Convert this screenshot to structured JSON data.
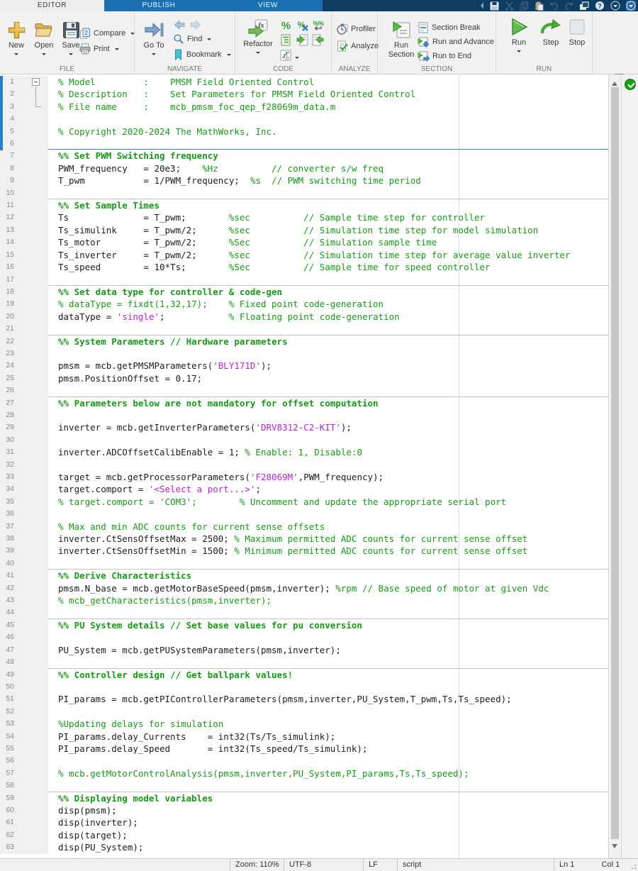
{
  "tabs": [
    "EDITOR",
    "PUBLISH",
    "VIEW"
  ],
  "toolbar": {
    "groups": [
      "FILE",
      "NAVIGATE",
      "CODE",
      "ANALYZE",
      "SECTION",
      "RUN"
    ],
    "file": {
      "new": "New",
      "open": "Open",
      "save": "Save",
      "compare": "Compare",
      "print": "Print"
    },
    "navigate": {
      "goto": "Go To",
      "find": "Find",
      "bookmark": "Bookmark"
    },
    "code": {
      "refactor": "Refactor"
    },
    "analyze": {
      "profiler": "Profiler",
      "analyze": "Analyze"
    },
    "section": {
      "run_line1": "Run",
      "run_line2": "Section",
      "section_break": "Section Break",
      "run_and_advance": "Run and Advance",
      "run_to_end": "Run to End"
    },
    "run": {
      "run": "Run",
      "step": "Step",
      "stop": "Stop"
    }
  },
  "status": {
    "zoom_label": "Zoom: 110%",
    "encoding": "UTF-8",
    "line_ending": "LF",
    "file_type": "script",
    "line": "Ln  1",
    "column": "Col  1"
  },
  "colors": {
    "comment_green": "#169916",
    "string_purple": "#b821cf",
    "section_marker_blue": "#2f86c4",
    "tab_navy": "#0e3c62",
    "tab_blue": "#1a70b1",
    "analyzer_ok_green": "#18a018"
  },
  "editor": {
    "current_section_lines": [
      1,
      6
    ],
    "lines": [
      {
        "n": 1,
        "segs": [
          [
            "% Model         :    PMSM Field Oriented Control",
            "com"
          ]
        ]
      },
      {
        "n": 2,
        "segs": [
          [
            "% Description   :    Set Parameters for PMSM Field Oriented Control",
            "com"
          ]
        ]
      },
      {
        "n": 3,
        "segs": [
          [
            "% File name     :    mcb_pmsm_foc_qep_f28069m_data.m",
            "com"
          ]
        ]
      },
      {
        "n": 4,
        "segs": []
      },
      {
        "n": 5,
        "segs": [
          [
            "% Copyright 2020-2024 The MathWorks, Inc.",
            "com"
          ]
        ]
      },
      {
        "n": 6,
        "segs": []
      },
      {
        "n": 7,
        "sb": "blue",
        "segs": [
          [
            "%% Set PWM Switching frequency",
            "sec"
          ]
        ]
      },
      {
        "n": 8,
        "segs": [
          [
            "PWM_frequency   = 20e3;    ",
            "code"
          ],
          [
            "%Hz          // converter s/w freq",
            "com"
          ]
        ]
      },
      {
        "n": 9,
        "segs": [
          [
            "T_pwm           = 1/PWM_frequency;  ",
            "code"
          ],
          [
            "%s  // PWM switching time period",
            "com"
          ]
        ]
      },
      {
        "n": 10,
        "segs": []
      },
      {
        "n": 11,
        "sb": "gray",
        "segs": [
          [
            "%% Set Sample Times",
            "sec"
          ]
        ]
      },
      {
        "n": 12,
        "segs": [
          [
            "Ts              = T_pwm;        ",
            "code"
          ],
          [
            "%sec          // Sample time step for controller",
            "com"
          ]
        ]
      },
      {
        "n": 13,
        "segs": [
          [
            "Ts_simulink     = T_pwm/2;      ",
            "code"
          ],
          [
            "%sec          // Simulation time step for model simulation",
            "com"
          ]
        ]
      },
      {
        "n": 14,
        "segs": [
          [
            "Ts_motor        = T_pwm/2;      ",
            "code"
          ],
          [
            "%Sec          // Simulation sample time",
            "com"
          ]
        ]
      },
      {
        "n": 15,
        "segs": [
          [
            "Ts_inverter     = T_pwm/2;      ",
            "code"
          ],
          [
            "%sec          // Simulation time step for average value inverter",
            "com"
          ]
        ]
      },
      {
        "n": 16,
        "segs": [
          [
            "Ts_speed        = 10*Ts;        ",
            "code"
          ],
          [
            "%Sec          // Sample time for speed controller",
            "com"
          ]
        ]
      },
      {
        "n": 17,
        "segs": []
      },
      {
        "n": 18,
        "sb": "gray",
        "segs": [
          [
            "%% Set data type for controller & code-gen",
            "sec"
          ]
        ]
      },
      {
        "n": 19,
        "segs": [
          [
            "% dataType = fixdt(1,32,17);    % Fixed point code-generation",
            "com"
          ]
        ]
      },
      {
        "n": 20,
        "segs": [
          [
            "dataType = ",
            "code"
          ],
          [
            "'single'",
            "str"
          ],
          [
            ";            ",
            "code"
          ],
          [
            "% Floating point code-generation",
            "com"
          ]
        ]
      },
      {
        "n": 21,
        "segs": []
      },
      {
        "n": 22,
        "sb": "gray",
        "segs": [
          [
            "%% System Parameters // Hardware parameters",
            "sec"
          ]
        ]
      },
      {
        "n": 23,
        "segs": []
      },
      {
        "n": 24,
        "segs": [
          [
            "pmsm = mcb.getPMSMParameters(",
            "code"
          ],
          [
            "'BLY171D'",
            "str"
          ],
          [
            ");",
            "code"
          ]
        ]
      },
      {
        "n": 25,
        "segs": [
          [
            "pmsm.PositionOffset = 0.17;",
            "code"
          ]
        ]
      },
      {
        "n": 26,
        "segs": []
      },
      {
        "n": 27,
        "sb": "gray",
        "segs": [
          [
            "%% Parameters below are not mandatory for offset computation",
            "sec"
          ]
        ]
      },
      {
        "n": 28,
        "segs": []
      },
      {
        "n": 29,
        "segs": [
          [
            "inverter = mcb.getInverterParameters(",
            "code"
          ],
          [
            "'DRV8312-C2-KIT'",
            "str"
          ],
          [
            ");",
            "code"
          ]
        ]
      },
      {
        "n": 30,
        "segs": []
      },
      {
        "n": 31,
        "segs": [
          [
            "inverter.ADCOffsetCalibEnable = 1; ",
            "code"
          ],
          [
            "% Enable: 1, Disable:0",
            "com"
          ]
        ]
      },
      {
        "n": 32,
        "segs": []
      },
      {
        "n": 33,
        "segs": [
          [
            "target = mcb.getProcessorParameters(",
            "code"
          ],
          [
            "'F28069M'",
            "str"
          ],
          [
            ",PWM_frequency);",
            "code"
          ]
        ]
      },
      {
        "n": 34,
        "segs": [
          [
            "target.comport = ",
            "code"
          ],
          [
            "'<Select a port...>'",
            "str"
          ],
          [
            ";",
            "code"
          ]
        ]
      },
      {
        "n": 35,
        "segs": [
          [
            "% target.comport = 'COM3';        % Uncomment and update the appropriate serial port",
            "com"
          ]
        ]
      },
      {
        "n": 36,
        "segs": []
      },
      {
        "n": 37,
        "segs": [
          [
            "% Max and min ADC counts for current sense offsets",
            "com"
          ]
        ]
      },
      {
        "n": 38,
        "segs": [
          [
            "inverter.CtSensOffsetMax = 2500; ",
            "code"
          ],
          [
            "% Maximum permitted ADC counts for current sense offset",
            "com"
          ]
        ]
      },
      {
        "n": 39,
        "segs": [
          [
            "inverter.CtSensOffsetMin = 1500; ",
            "code"
          ],
          [
            "% Minimum permitted ADC counts for current sense offset",
            "com"
          ]
        ]
      },
      {
        "n": 40,
        "segs": []
      },
      {
        "n": 41,
        "sb": "gray",
        "segs": [
          [
            "%% Derive Characteristics",
            "sec"
          ]
        ]
      },
      {
        "n": 42,
        "segs": [
          [
            "pmsm.N_base = mcb.getMotorBaseSpeed(pmsm,inverter); ",
            "code"
          ],
          [
            "%rpm // Base speed of motor at given Vdc",
            "com"
          ]
        ]
      },
      {
        "n": 43,
        "segs": [
          [
            "% mcb_getCharacteristics(pmsm,inverter);",
            "com"
          ]
        ]
      },
      {
        "n": 44,
        "segs": []
      },
      {
        "n": 45,
        "sb": "gray",
        "segs": [
          [
            "%% PU System details // Set base values for pu conversion",
            "sec"
          ]
        ]
      },
      {
        "n": 46,
        "segs": []
      },
      {
        "n": 47,
        "segs": [
          [
            "PU_System = mcb.getPUSystemParameters(pmsm,inverter);",
            "code"
          ]
        ]
      },
      {
        "n": 48,
        "segs": []
      },
      {
        "n": 49,
        "sb": "gray",
        "segs": [
          [
            "%% Controller design // Get ballpark values!",
            "sec"
          ]
        ]
      },
      {
        "n": 50,
        "segs": []
      },
      {
        "n": 51,
        "segs": [
          [
            "PI_params = mcb.getPIControllerParameters(pmsm,inverter,PU_System,T_pwm,Ts,Ts_speed);",
            "code"
          ]
        ]
      },
      {
        "n": 52,
        "segs": []
      },
      {
        "n": 53,
        "segs": [
          [
            "%Updating delays for simulation",
            "com"
          ]
        ]
      },
      {
        "n": 54,
        "segs": [
          [
            "PI_params.delay_Currents    = int32(Ts/Ts_simulink);",
            "code"
          ]
        ]
      },
      {
        "n": 55,
        "segs": [
          [
            "PI_params.delay_Speed       = int32(Ts_speed/Ts_simulink);",
            "code"
          ]
        ]
      },
      {
        "n": 56,
        "segs": []
      },
      {
        "n": 57,
        "segs": [
          [
            "% mcb.getMotorControlAnalysis(pmsm,inverter,PU_System,PI_params,Ts,Ts_speed);",
            "com"
          ]
        ]
      },
      {
        "n": 58,
        "segs": []
      },
      {
        "n": 59,
        "sb": "gray",
        "segs": [
          [
            "%% Displaying model variables",
            "sec"
          ]
        ]
      },
      {
        "n": 60,
        "segs": [
          [
            "disp(pmsm);",
            "code"
          ]
        ]
      },
      {
        "n": 61,
        "segs": [
          [
            "disp(inverter);",
            "code"
          ]
        ]
      },
      {
        "n": 62,
        "segs": [
          [
            "disp(target);",
            "code"
          ]
        ]
      },
      {
        "n": 63,
        "segs": [
          [
            "disp(PU_System);",
            "code"
          ]
        ]
      }
    ]
  }
}
